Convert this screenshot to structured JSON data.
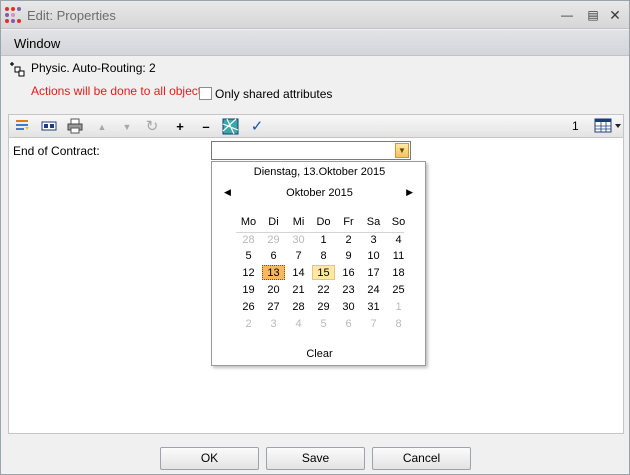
{
  "window": {
    "title": "Edit: Properties",
    "minimize_icon": "minimize-icon",
    "maximize_icon": "maximize-icon",
    "close_icon": "close-icon"
  },
  "section": {
    "label": "Window"
  },
  "info": {
    "text": "Physic. Auto-Routing: 2",
    "icon": "auto-routing-icon"
  },
  "warning": {
    "text": "Actions will be done to all objects",
    "color": "#e0201c"
  },
  "shared": {
    "label": "Only shared attributes",
    "checked": false
  },
  "toolbar": {
    "count": "1",
    "buttons": [
      "filter-icon",
      "layout-icon",
      "print-icon",
      "arrow-up-icon",
      "arrow-down-icon",
      "refresh-icon",
      "plus-icon",
      "minus-icon",
      "map-icon",
      "checkmark-icon"
    ],
    "grid_icon": "grid-view-icon"
  },
  "form": {
    "field_label": "End of Contract:",
    "field_value": ""
  },
  "calendar": {
    "today_label": "Dienstag, 13.Oktober 2015",
    "month_label": "Oktober 2015",
    "weekdays": [
      "Mo",
      "Di",
      "Mi",
      "Do",
      "Fr",
      "Sa",
      "So"
    ],
    "weeks": [
      [
        "28",
        "29",
        "30",
        "1",
        "2",
        "3",
        "4"
      ],
      [
        "5",
        "6",
        "7",
        "8",
        "9",
        "10",
        "11"
      ],
      [
        "12",
        "13",
        "14",
        "15",
        "16",
        "17",
        "18"
      ],
      [
        "19",
        "20",
        "21",
        "22",
        "23",
        "24",
        "25"
      ],
      [
        "26",
        "27",
        "28",
        "29",
        "30",
        "31",
        "1"
      ],
      [
        "2",
        "3",
        "4",
        "5",
        "6",
        "7",
        "8"
      ]
    ],
    "selected_day": "13",
    "today_highlight": "15",
    "clear_label": "Clear"
  },
  "buttons": {
    "ok": "OK",
    "save": "Save",
    "cancel": "Cancel"
  }
}
